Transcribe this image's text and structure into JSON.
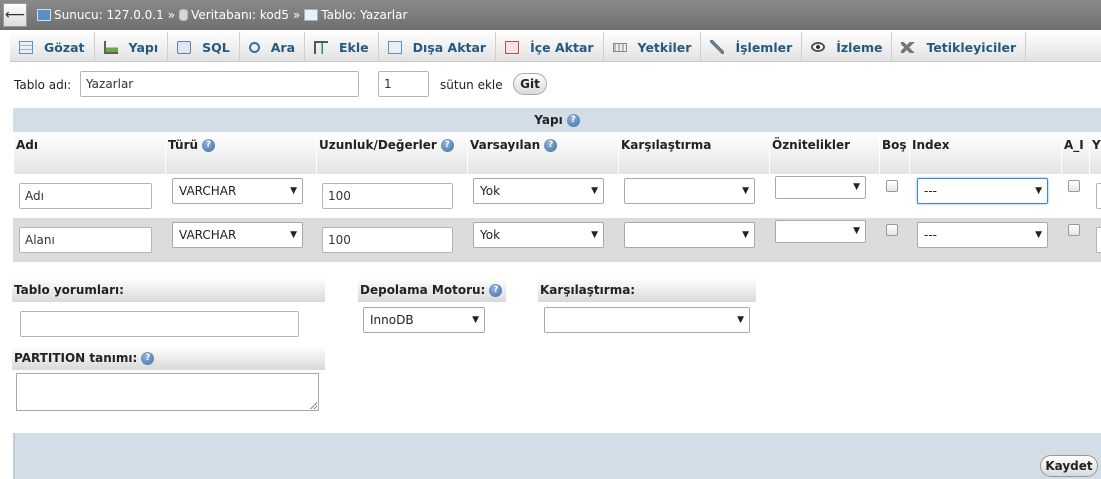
{
  "breadcrumb": {
    "back_label": "⟵",
    "items": [
      {
        "label": "Sunucu: 127.0.0.1"
      },
      {
        "label": "Veritabanı: kod5"
      },
      {
        "label": "Tablo: Yazarlar"
      }
    ],
    "separator": "»"
  },
  "tabs": [
    {
      "label": "Gözat",
      "icon": "browse-icon"
    },
    {
      "label": "Yapı",
      "icon": "structure-icon"
    },
    {
      "label": "SQL",
      "icon": "sql-icon"
    },
    {
      "label": "Ara",
      "icon": "search-icon"
    },
    {
      "label": "Ekle",
      "icon": "insert-icon"
    },
    {
      "label": "Dışa Aktar",
      "icon": "export-icon"
    },
    {
      "label": "İçe Aktar",
      "icon": "import-icon"
    },
    {
      "label": "Yetkiler",
      "icon": "privileges-icon"
    },
    {
      "label": "İşlemler",
      "icon": "operations-icon"
    },
    {
      "label": "İzleme",
      "icon": "tracking-icon"
    },
    {
      "label": "Tetikleyiciler",
      "icon": "triggers-icon"
    }
  ],
  "table_name": {
    "label": "Tablo adı:",
    "value": "Yazarlar",
    "add_count": "1",
    "add_label": "sütun ekle",
    "go_label": "Git"
  },
  "structure": {
    "title": "Yapı",
    "help": "?",
    "columns": [
      "Adı",
      "Türü",
      "Uzunluk/Değerler",
      "Varsayılan",
      "Karşılaştırma",
      "Öznitelikler",
      "Boş",
      "Index",
      "A_I",
      "Y"
    ],
    "rows": [
      {
        "name": "Adı",
        "type": "VARCHAR",
        "length": "100",
        "default": "Yok",
        "collation": "",
        "attributes": "",
        "null": false,
        "index": "---",
        "ai": false
      },
      {
        "name": "Alanı",
        "type": "VARCHAR",
        "length": "100",
        "default": "Yok",
        "collation": "",
        "attributes": "",
        "null": false,
        "index": "---",
        "ai": false
      }
    ]
  },
  "options": {
    "comments_label": "Tablo yorumları:",
    "comments_value": "",
    "engine_label": "Depolama Motoru:",
    "engine_value": "InnoDB",
    "collation_label": "Karşılaştırma:",
    "collation_value": "",
    "partition_label": "PARTITION tanımı:"
  },
  "save_label": "Kaydet",
  "colors": {
    "topbar": "#7a7a7a",
    "link": "#235a81",
    "header_band": "#d2dde6",
    "focus": "#3f86d6"
  }
}
